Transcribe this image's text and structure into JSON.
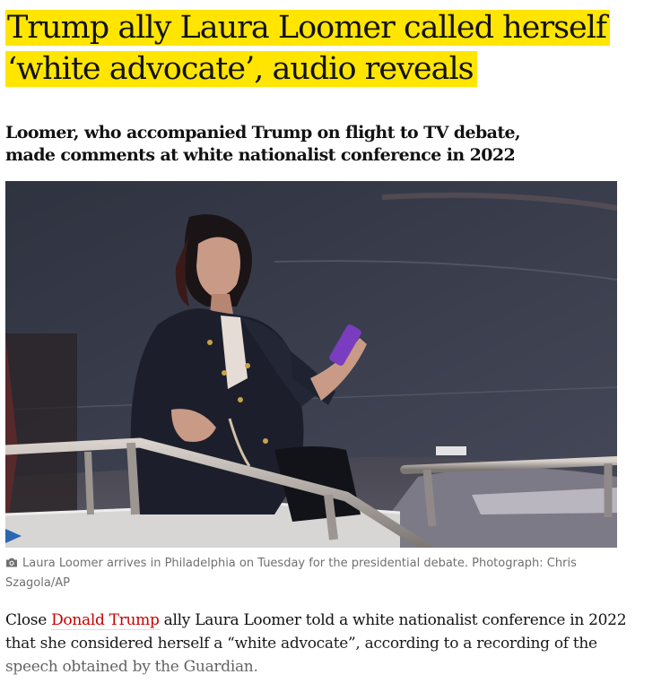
{
  "article": {
    "headline_line1": "Trump ally Laura Loomer called herself",
    "headline_line2": "‘white advocate’, audio reveals",
    "standfirst": "Loomer, who accompanied Trump on flight to TV debate, made comments at white nationalist conference in 2022",
    "caption": "Laura Loomer arrives in Philadelphia on Tuesday for the presidential debate. Photograph: Chris Szagola/AP",
    "caption_icon": "camera-icon",
    "body_before_link": "Close ",
    "body_link": "Donald Trump",
    "body_after_link": " ally Laura Loomer told a white nationalist conference in 2022 that she considered herself a “white advocate”, according to a recording of the speech obtained by the Guardian."
  },
  "colors": {
    "highlight": "#ffe500",
    "link": "#c70000",
    "text": "#121212",
    "caption": "#707070"
  }
}
